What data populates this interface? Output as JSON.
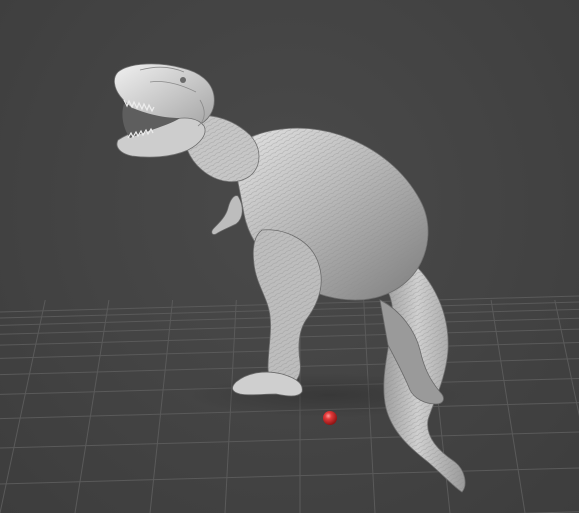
{
  "viewport": {
    "background_color": "#444444",
    "grid_line_color": "#5a5a5a",
    "grid_visible": true,
    "model": {
      "name": "tyrannosaurus-rex",
      "material": "clay-gray",
      "base_color": "#c9c9c9"
    },
    "pivot_marker": {
      "color": "#e02a2a",
      "shape": "sphere"
    }
  }
}
